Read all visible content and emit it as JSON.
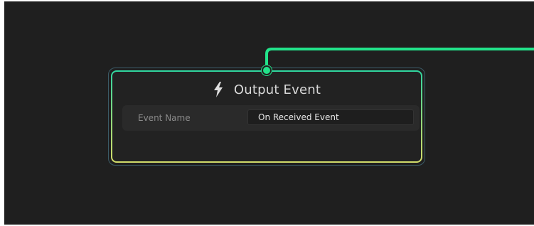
{
  "node": {
    "title": "Output Event",
    "icon": "lightning-bolt-icon",
    "property": {
      "label": "Event Name",
      "value": "On Received Event"
    }
  },
  "colors": {
    "canvas_background": "#1f1f1f",
    "node_background": "#222222",
    "wire": "#22e38a",
    "border_gradient_top": "#2fd6a0",
    "border_gradient_bottom": "#d2dc6a"
  }
}
